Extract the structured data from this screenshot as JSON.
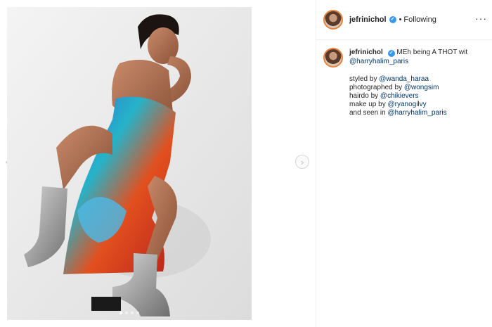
{
  "post": {
    "author": "jefrinichol",
    "follow_status": "Following",
    "separator": "•",
    "more_icon": "more-options-icon",
    "caption_text": "MEh being A THOT wit",
    "caption_mention": "@harryhalim_paris",
    "credits": [
      {
        "prefix": "styled by ",
        "mention": "@wanda_haraa"
      },
      {
        "prefix": "photographed by ",
        "mention": "@wongsim"
      },
      {
        "prefix": "hairdo by ",
        "mention": "@chikievers"
      },
      {
        "prefix": "make up by ",
        "mention": "@ryanogilvy"
      },
      {
        "prefix": "and seen in ",
        "mention": "@harryhalim_paris"
      }
    ]
  },
  "carousel": {
    "slide_count": 4,
    "active_index": 1,
    "next_icon": "chevron-right-icon",
    "prev_icon": "chevron-left-icon"
  },
  "colors": {
    "link": "#003569",
    "verified": "#3897f0",
    "story_ring": "#e8843c",
    "border": "#efefef"
  }
}
